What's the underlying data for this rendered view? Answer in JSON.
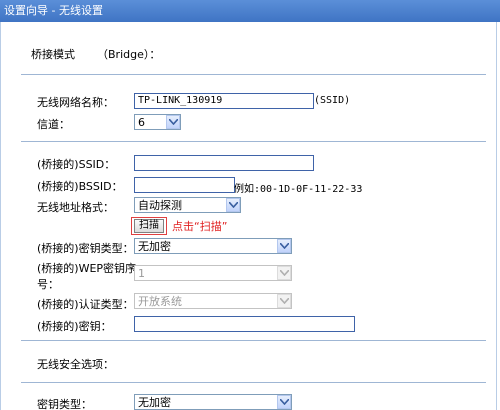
{
  "window": {
    "title": "设置向导 - 无线设置"
  },
  "bridge": {
    "mode_label": "桥接模式",
    "mode_value": "（Bridge）：",
    "ssid_label": "无线网络名称：",
    "ssid_value": "TP-LINK_130919",
    "ssid_suffix": "(SSID)",
    "channel_label": "信道：",
    "channel_value": "6",
    "bridged_ssid_label": "(桥接的)SSID：",
    "bridged_ssid_value": "",
    "bridged_bssid_label": "(桥接的)BSSID：",
    "bridged_bssid_value": "",
    "bssid_example": "例如:00-1D-0F-11-22-33",
    "addr_format_label": "无线地址格式：",
    "addr_format_value": "自动探测",
    "scan_label": "扫描",
    "scan_annotation": "点击“扫描”",
    "key_type_label": "(桥接的)密钥类型：",
    "key_type_value": "无加密",
    "wep_index_label_1": "(桥接的)WEP密钥序",
    "wep_index_label_2": "号：",
    "wep_index_value": "1",
    "auth_label": "(桥接的)认证类型：",
    "auth_value": "开放系统",
    "key_label": "(桥接的)密钥：",
    "key_value": ""
  },
  "security": {
    "section_label": "无线安全选项：",
    "key_type_label": "密钥类型：",
    "key_type_value": "无加密"
  }
}
